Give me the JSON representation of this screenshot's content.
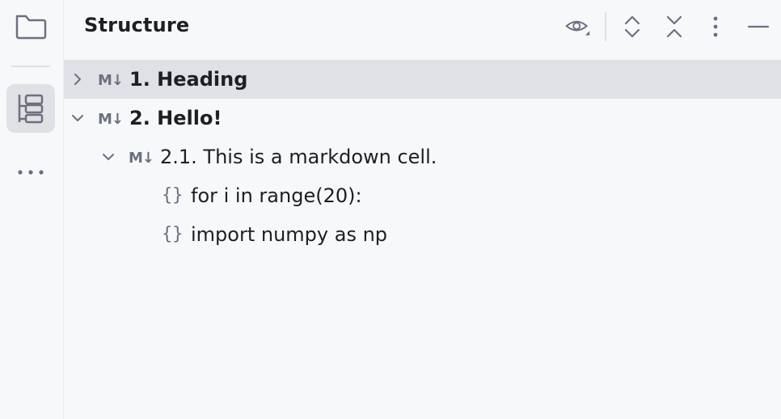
{
  "panel": {
    "title": "Structure"
  },
  "toolbar": {
    "preview_icon": "eye-icon",
    "expand_icon": "expand-all-icon",
    "collapse_icon": "collapse-all-icon",
    "more_icon": "more-vertical-icon",
    "hide_icon": "minimize-icon"
  },
  "tree": {
    "items": [
      {
        "label": "1. Heading",
        "marker": "M↓",
        "expanded": false,
        "selected": true
      },
      {
        "label": "2. Hello!",
        "marker": "M↓",
        "expanded": true,
        "selected": false
      },
      {
        "label": "2.1. This is a markdown cell.",
        "marker": "M↓",
        "expanded": true,
        "selected": false
      },
      {
        "label": "for i in range(20):",
        "marker": "{}"
      },
      {
        "label": "import numpy as np",
        "marker": "{}"
      }
    ]
  },
  "colors": {
    "background": "#f7f8fa",
    "selection": "#dfe1e5",
    "icon": "#6c707e"
  }
}
